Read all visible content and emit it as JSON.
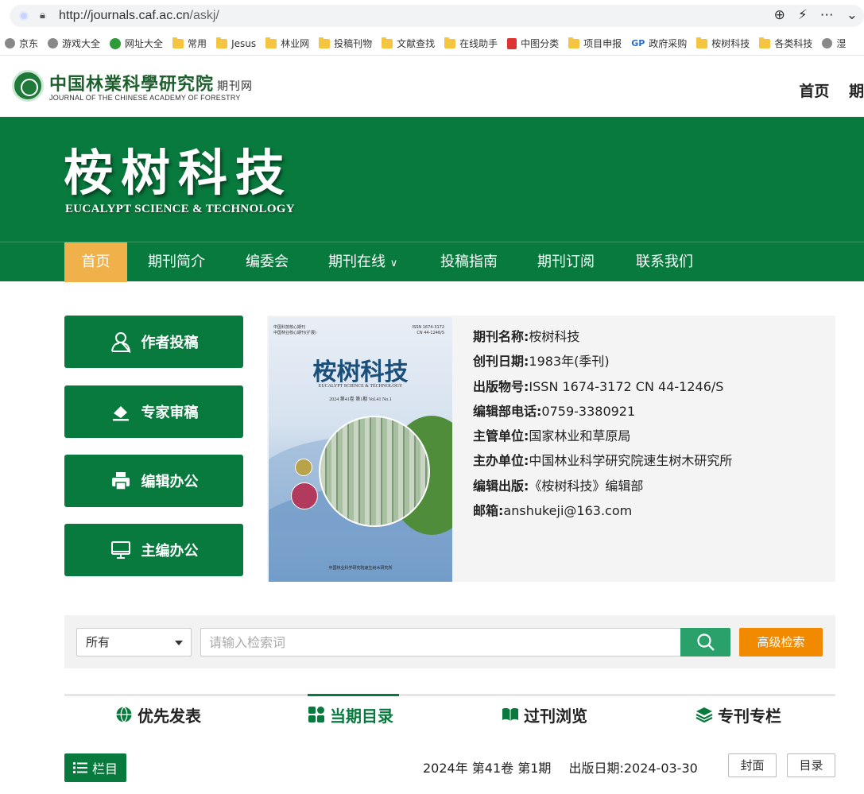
{
  "browser": {
    "url_host": "http://journals.caf.ac.cn",
    "url_path": "/askj/",
    "bookmarks": [
      "京东",
      "游戏大全",
      "网址大全",
      "常用",
      "Jesus",
      "林业网",
      "投稿刊物",
      "文献查找",
      "在线助手",
      "中图分类",
      "项目申报",
      "政府采购",
      "桉树科技",
      "各类科技",
      "湿"
    ]
  },
  "header": {
    "logo_cn": "中国林業科學研究院",
    "logo_cn_sub": "期刊网",
    "logo_en": "JOURNAL OF THE CHINESE ACADEMY OF FORESTRY",
    "top_nav": [
      "首页",
      "期"
    ]
  },
  "banner": {
    "title": "桉树科技",
    "subtitle": "EUCALYPT SCIENCE & TECHNOLOGY"
  },
  "nav": {
    "items": [
      "首页",
      "期刊简介",
      "编委会",
      "期刊在线",
      "投稿指南",
      "期刊订阅",
      "联系我们"
    ]
  },
  "side_buttons": [
    "作者投稿",
    "专家审稿",
    "编辑办公",
    "主编办公"
  ],
  "cover": {
    "top_left_1": "中国科技核心期刊",
    "top_left_2": "中国林业核心期刊(扩展)",
    "top_right_1": "ISSN 1674-3172",
    "top_right_2": "CN 44-1246/S",
    "title": "桉树科技",
    "en": "EUCALYPT SCIENCE & TECHNOLOGY",
    "vol": "2024  第41卷  第1期   Vol.41  No.1",
    "bottom": "中国林业科学研究院速生树木研究所"
  },
  "info": [
    {
      "k": "期刊名称:",
      "v": "桉树科技"
    },
    {
      "k": "创刊日期:",
      "v": "1983年(季刊)"
    },
    {
      "k": "出版物号:",
      "v": "ISSN 1674-3172 CN 44-1246/S"
    },
    {
      "k": "编辑部电话:",
      "v": "0759-3380921"
    },
    {
      "k": "主管单位:",
      "v": "国家林业和草原局"
    },
    {
      "k": "主办单位:",
      "v": "中国林业科学研究院速生树木研究所"
    },
    {
      "k": "编辑出版:",
      "v": "《桉树科技》编辑部"
    },
    {
      "k": "邮箱:",
      "v": "anshukeji@163.com"
    }
  ],
  "search": {
    "scope": "所有",
    "placeholder": "请输入检索词",
    "advanced": "高级检索"
  },
  "tabs": [
    "优先发表",
    "当期目录",
    "过刊浏览",
    "专刊专栏"
  ],
  "issue": {
    "lanmu": "栏目",
    "vol": "2024年 第41卷 第1期",
    "date": "出版日期:2024-03-30",
    "cover_btn": "封面",
    "toc_btn": "目录"
  },
  "colors": {
    "brand_green": "#087a3d",
    "nav_active": "#f0b14a",
    "search_btn": "#2aa06b",
    "advanced_btn": "#f28a00"
  }
}
